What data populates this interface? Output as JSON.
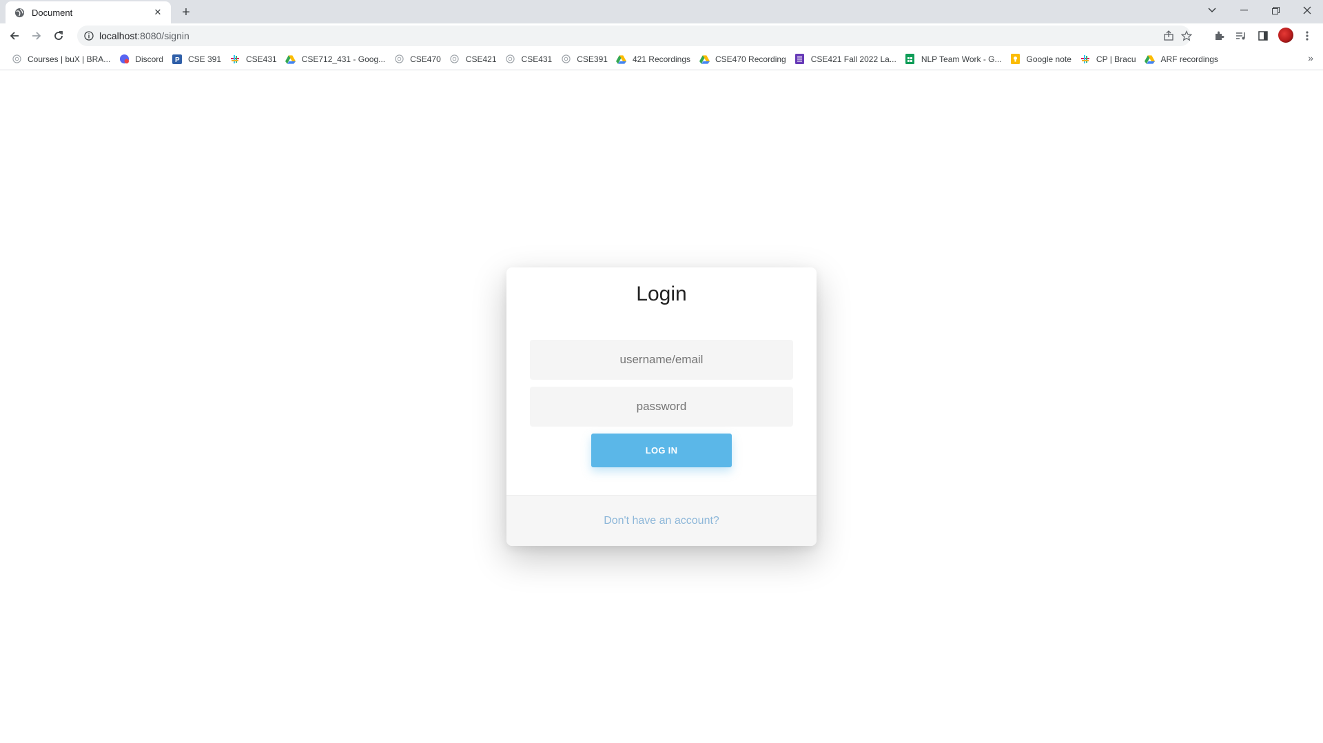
{
  "browser": {
    "tab_title": "Document",
    "url_host": "localhost",
    "url_rest": ":8080/signin"
  },
  "bookmarks": [
    {
      "label": "Courses | buX | BRA...",
      "icon": "globe-icon",
      "color": "#9aa0a6"
    },
    {
      "label": "Discord",
      "icon": "discord-icon",
      "color": "#5865f2"
    },
    {
      "label": "CSE 391",
      "icon": "p-icon",
      "color": "#2f5fa8"
    },
    {
      "label": "CSE431",
      "icon": "slack-icon",
      "color": "#e01e5a"
    },
    {
      "label": "CSE712_431 - Goog...",
      "icon": "drive-icon",
      "color": "#34a853"
    },
    {
      "label": "CSE470",
      "icon": "globe-icon",
      "color": "#9aa0a6"
    },
    {
      "label": "CSE421",
      "icon": "globe-icon",
      "color": "#9aa0a6"
    },
    {
      "label": "CSE431",
      "icon": "globe-icon",
      "color": "#9aa0a6"
    },
    {
      "label": "CSE391",
      "icon": "globe-icon",
      "color": "#9aa0a6"
    },
    {
      "label": "421 Recordings",
      "icon": "drive-icon",
      "color": "#34a853"
    },
    {
      "label": "CSE470 Recording",
      "icon": "drive-icon",
      "color": "#34a853"
    },
    {
      "label": "CSE421 Fall 2022 La...",
      "icon": "forms-icon",
      "color": "#673ab7"
    },
    {
      "label": "NLP Team Work - G...",
      "icon": "sheets-icon",
      "color": "#0f9d58"
    },
    {
      "label": "Google note",
      "icon": "keep-icon",
      "color": "#fbbc04"
    },
    {
      "label": "CP | Bracu",
      "icon": "slack-icon",
      "color": "#e01e5a"
    },
    {
      "label": "ARF recordings",
      "icon": "drive-icon",
      "color": "#34a853"
    }
  ],
  "login": {
    "title": "Login",
    "username_placeholder": "username/email",
    "password_placeholder": "password",
    "button_label": "LOG IN",
    "signup_link": "Don't have an account?"
  },
  "colors": {
    "accent": "#5bb7e8",
    "link": "#8db7d9"
  }
}
